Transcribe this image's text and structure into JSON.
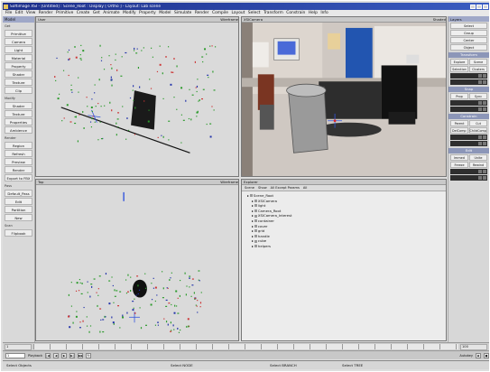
{
  "window": {
    "title": "Softimage XSI - [Untitled] : Scene_Root : Display [ Ortho ] - Layout: Lab scene",
    "icon": "xsi-logo-icon"
  },
  "menubar": [
    "File",
    "Edit",
    "View",
    "Render",
    "Primitive",
    "Create",
    "Get",
    "Animate",
    "Modify",
    "Property",
    "Model",
    "Simulate",
    "Render",
    "Compile",
    "Layout",
    "Select",
    "Transform",
    "Constrain",
    "Help",
    "Info"
  ],
  "left_panel": {
    "title": "Model",
    "sections": [
      {
        "label": "Get",
        "buttons": [
          "Primitive",
          "Camera",
          "Light",
          "Material",
          "Property",
          "Shader",
          "Texture",
          "Clip"
        ]
      },
      {
        "label": "Modify",
        "buttons": [
          "Shader",
          "Texture",
          "Properties",
          "Ambience"
        ]
      },
      {
        "label": "Render",
        "buttons": [
          "Region",
          "Refresh",
          "Preview",
          "Render"
        ]
      },
      {
        "label": "",
        "buttons": [
          "Export to FBX"
        ]
      },
      {
        "label": "Pass",
        "buttons": [
          "Default_Pass",
          "Edit",
          "Partition",
          "New"
        ]
      },
      {
        "label": "Scan",
        "buttons": [
          "Flipbook"
        ]
      }
    ]
  },
  "viewports": {
    "top_left": {
      "name": "User",
      "mode": "Wireframe"
    },
    "top_right": {
      "name": "XSICamera",
      "mode": "Shaded"
    },
    "bottom_left": {
      "name": "Top",
      "mode": "Wireframe"
    }
  },
  "explorer": {
    "title": "Explorer",
    "toolbar": [
      "Scene",
      "Show",
      "All Except Params",
      "All"
    ],
    "items": [
      {
        "label": "Scene_Root",
        "depth": 0
      },
      {
        "label": "XSICamera",
        "depth": 1
      },
      {
        "label": "light",
        "depth": 1
      },
      {
        "label": "Camera_Root",
        "depth": 1
      },
      {
        "label": "XSICamera_Interest",
        "depth": 1
      },
      {
        "label": "container",
        "depth": 1
      },
      {
        "label": "cover",
        "depth": 1
      },
      {
        "label": "grid",
        "depth": 1
      },
      {
        "label": "handle",
        "depth": 1
      },
      {
        "label": "cube",
        "depth": 1
      },
      {
        "label": "helpers",
        "depth": 1
      }
    ]
  },
  "right_panel": {
    "title": "Layers",
    "buttons_top": [
      "Select",
      "Group",
      "Center",
      "Object"
    ],
    "sections": [
      {
        "label": "Transform",
        "rows": [
          [
            "Explore",
            "Scene"
          ],
          [
            "Selection",
            "Clusters"
          ]
        ]
      },
      {
        "label": "Snap",
        "rows": [
          [
            "Prop",
            "Sync"
          ]
        ]
      },
      {
        "label": "Constrain",
        "rows": [
          [
            "Parent",
            "Cut"
          ],
          [
            "DelComp",
            "ChildComp"
          ]
        ]
      },
      {
        "label": "Edit",
        "rows": [
          [
            "Immed",
            "Unite"
          ],
          [
            "Freeze",
            "Rewind"
          ]
        ]
      }
    ]
  },
  "timeline": {
    "start": "1",
    "end": "100"
  },
  "playback": {
    "frame": "1",
    "mode_label": "Playback",
    "auto_label": "Autokey"
  },
  "status": {
    "select_objects": "Select Objects",
    "select_node": "Select NODE",
    "select_branch": "Select BRANCH",
    "select_tree": "Select TREE"
  }
}
